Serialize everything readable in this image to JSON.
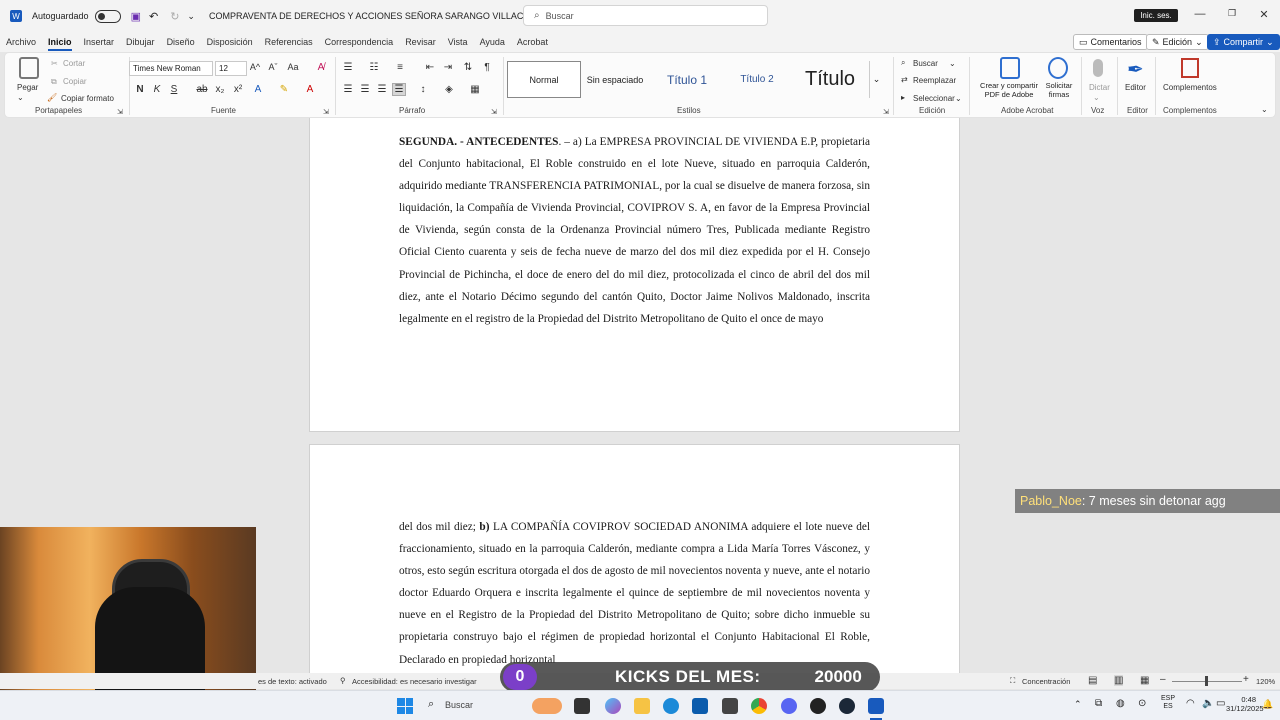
{
  "titlebar": {
    "autosave_label": "Autoguardado",
    "doc_title": "COMPRAVENTA DE DERECHOS Y ACCIONES SEÑORA SARANGO VILLACIS",
    "search_placeholder": "Buscar",
    "signin": "Inic. ses."
  },
  "menu": {
    "tabs": [
      "Archivo",
      "Inicio",
      "Insertar",
      "Dibujar",
      "Diseño",
      "Disposición",
      "Referencias",
      "Correspondencia",
      "Revisar",
      "Vista",
      "Ayuda",
      "Acrobat"
    ],
    "comments": "Comentarios",
    "editing": "Edición",
    "share": "Compartir"
  },
  "ribbon": {
    "clipboard": {
      "paste": "Pegar",
      "cut": "Cortar",
      "copy": "Copiar",
      "format_painter": "Copiar formato",
      "label": "Portapapeles"
    },
    "font": {
      "name": "Times New Roman",
      "size": "12",
      "label": "Fuente"
    },
    "paragraph": {
      "label": "Párrafo"
    },
    "styles": {
      "items": [
        "Normal",
        "Sin espaciado",
        "Título 1",
        "Título 2",
        "Título"
      ],
      "label": "Estilos"
    },
    "editing": {
      "find": "Buscar",
      "replace": "Reemplazar",
      "select": "Seleccionar",
      "label": "Edición"
    },
    "adobe": {
      "create_pdf": "Crear y compartir PDF de Adobe",
      "sign": "Solicitar firmas",
      "label": "Adobe Acrobat"
    },
    "voice": {
      "dictate": "Dictar",
      "label": "Voz"
    },
    "editor": {
      "editor": "Editor",
      "label": "Editor"
    },
    "addins": {
      "addins": "Complementos",
      "label": "Complementos"
    }
  },
  "document": {
    "page1": {
      "heading": "SEGUNDA. - ANTECEDENTES",
      "body": ". – a) La EMPRESA PROVINCIAL DE VIVIENDA E.P, propietaria del Conjunto habitacional, El Roble construido en el lote Nueve, situado en parroquia Calderón, adquirido mediante TRANSFERENCIA PATRIMONIAL, por la cual se disuelve de manera forzosa, sin liquidación, la Compañía de Vivienda Provincial, COVIPROV S. A, en favor de la Empresa Provincial de Vivienda, según consta de la Ordenanza Provincial número Tres, Publicada mediante Registro Oficial Ciento cuarenta y seis de fecha nueve de marzo del dos mil diez expedida por el H. Consejo Provincial de Pichincha, el doce de enero del do mil diez, protocolizada el cinco de abril del dos mil diez, ante el Notario Décimo segundo del cantón Quito, Doctor Jaime Nolivos Maldonado, inscrita legalmente en el registro de la Propiedad del Distrito Metropolitano de Quito el once de mayo"
    },
    "page2": {
      "lead": "del dos mil diez; ",
      "bold": "b)",
      "body": " LA COMPAÑÍA COVIPROV SOCIEDAD ANONIMA adquiere el lote nueve del fraccionamiento, situado en la parroquia Calderón, mediante compra a Lida María Torres Vásconez, y otros, esto según escritura otorgada el dos de agosto de mil novecientos noventa y nueve, ante el notario doctor Eduardo Orquera e inscrita legalmente el quince de septiembre de mil novecientos noventa y nueve en el Registro de la Propiedad del Distrito Metropolitano de Quito; sobre dicho inmueble su propietaria construyo bajo el régimen de propiedad horizontal el Conjunto Habitacional El Roble, Declarado en propiedad horizontal"
    }
  },
  "overlay": {
    "chat_user": "Pablo_Noe",
    "chat_message": " : 7 meses sin detonar agg",
    "kicks_count": "0",
    "kicks_label": "KICKS DEL MES:",
    "kicks_goal": "20000"
  },
  "statusbar": {
    "text_prediction": "es de texto: activado",
    "accessibility": "Accesibilidad: es necesario investigar",
    "focus": "Concentración",
    "zoom": "120%"
  },
  "taskbar": {
    "search": "Buscar",
    "lang_top": "ESP",
    "lang_bottom": "ES",
    "time": "0:48",
    "date": "31/12/2025"
  },
  "colors": {
    "accent": "#185abd",
    "share_bg": "#185abd",
    "kicks_purple": "#7b3fc8"
  }
}
